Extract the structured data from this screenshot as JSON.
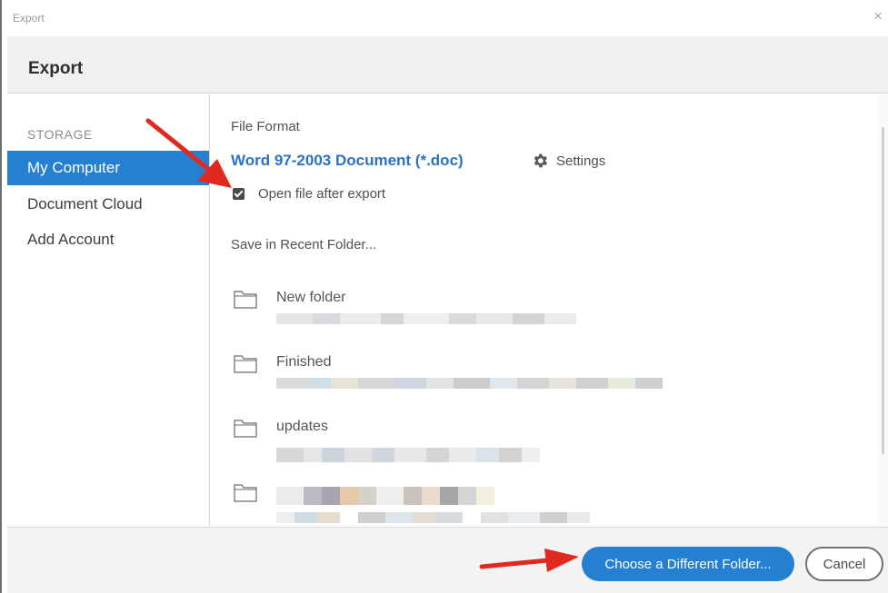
{
  "window": {
    "title": "Export",
    "close_glyph": "×"
  },
  "dialog": {
    "title": "Export"
  },
  "sidebar": {
    "section_label": "STORAGE",
    "items": [
      {
        "label": "My Computer",
        "active": true
      },
      {
        "label": "Document Cloud",
        "active": false
      },
      {
        "label": "Add Account",
        "active": false
      }
    ]
  },
  "main": {
    "file_format_label": "File Format",
    "file_format_value": "Word 97-2003 Document (*.doc)",
    "settings_label": "Settings",
    "settings_icon": "gear-icon",
    "open_after_export": {
      "label": "Open file after export",
      "checked": true
    },
    "recent_folder_label": "Save in Recent Folder...",
    "recent_folders": [
      {
        "name": "New folder",
        "path_redacted": true
      },
      {
        "name": "Finished",
        "path_redacted": true
      },
      {
        "name": "updates",
        "path_redacted": true
      },
      {
        "name": "",
        "path_redacted": true
      }
    ]
  },
  "footer": {
    "primary_button": "Choose a Different Folder...",
    "cancel_button": "Cancel"
  },
  "colors": {
    "accent": "#2680d2",
    "link": "#2b72c4",
    "annotation_arrow": "#e02a1f"
  }
}
